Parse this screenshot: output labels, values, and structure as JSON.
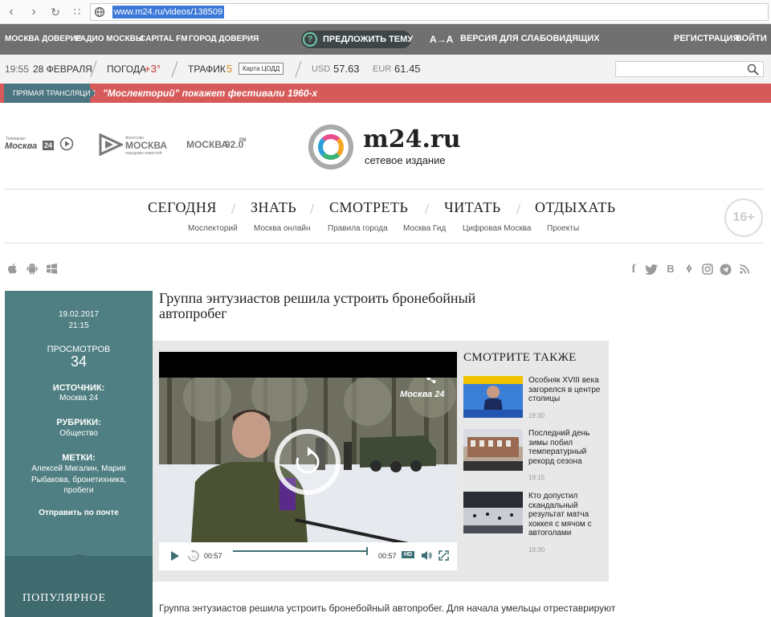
{
  "browser": {
    "url": "www.m24.ru/videos/138509"
  },
  "topnav": {
    "links": [
      "МОСКВА ДОВЕРИЕ",
      "РАДИО МОСКВЫ",
      "CAPITAL FM",
      "ГОРОД ДОВЕРИЯ"
    ],
    "suggest": "ПРЕДЛОЖИТЬ ТЕМУ",
    "accessibility_glyph": "А→А",
    "accessibility": "ВЕРСИЯ ДЛЯ СЛАБОВИДЯЩИХ",
    "register": "РЕГИСТРАЦИЯ",
    "login": "ВОЙТИ"
  },
  "info": {
    "time": "19:55",
    "date": "28 ФЕВРАЛЯ",
    "weather_label": "ПОГОДА",
    "weather_value": "+3°",
    "traffic_label": "ТРАФИК",
    "traffic_value": "5",
    "traffic_map": "Карта ЦОДД",
    "usd_label": "USD",
    "usd_value": "57.63",
    "eur_label": "EUR",
    "eur_value": "61.45"
  },
  "live": {
    "label": "ПРЯМАЯ ТРАНСЛЯЦИЯ",
    "text": "\"Мослекторий\" покажет фестивали 1960-х"
  },
  "logos": {
    "tv_small": "Телеканал",
    "tv": "Москва",
    "tv_num": "24",
    "agency_small": "Агентство",
    "agency": "МОСКВА",
    "agency_sub": "городских новостей",
    "radio": "МОСКВА",
    "radio_num": "92.0",
    "radio_fm": "FM",
    "brand": "m24.ru",
    "brand_sub": "сетевое издание"
  },
  "nav": {
    "main": [
      "СЕГОДНЯ",
      "ЗНАТЬ",
      "СМОТРЕТЬ",
      "ЧИТАТЬ",
      "ОТДЫХАТЬ"
    ],
    "sub": [
      "Мослекторий",
      "Москва онлайн",
      "Правила города",
      "Москва Гид",
      "Цифровая Москва",
      "Проекты"
    ],
    "age": "16+"
  },
  "sidebar": {
    "date": "19.02.2017",
    "time": "21:15",
    "views_label": "ПРОСМОТРОВ",
    "views": "34",
    "source_label": "ИСТОЧНИК:",
    "source": "Москва 24",
    "rubric_label": "РУБРИКИ:",
    "rubric": "Общество",
    "tags_label": "МЕТКИ:",
    "tags": "Алексей Мигалин, Мария Рыбакова, бронетихника, пробеги",
    "mail": "Отправить по почте",
    "popular": "ПОПУЛЯРНОЕ"
  },
  "article": {
    "title": "Группа энтузиастов решила устроить бронебойный автопробег",
    "lead": "Группа энтузиастов решила устроить бронебойный автопробег. Для начала умельцы отреставрируют"
  },
  "video": {
    "watermark": "Москва 24",
    "time_current": "00:57",
    "time_total": "00:57",
    "hd": "HD",
    "progress": 1.0,
    "rewind": "10"
  },
  "see_also": {
    "title": "СМОТРИТЕ ТАКЖЕ",
    "items": [
      {
        "title": "Особняк XVIII века загорелся в центре столицы",
        "time": "19:30"
      },
      {
        "title": "Последний день зимы побил температурный рекорд сезона",
        "time": "19:15"
      },
      {
        "title": "Кто допустил скандальный результат матча хоккея с мячом с автоголами",
        "time": "18:30"
      }
    ]
  },
  "colors": {
    "topnav": "#707070",
    "live": "#d75a5a",
    "sidebar": "#4f7f82",
    "accent": "#3c6f74"
  }
}
